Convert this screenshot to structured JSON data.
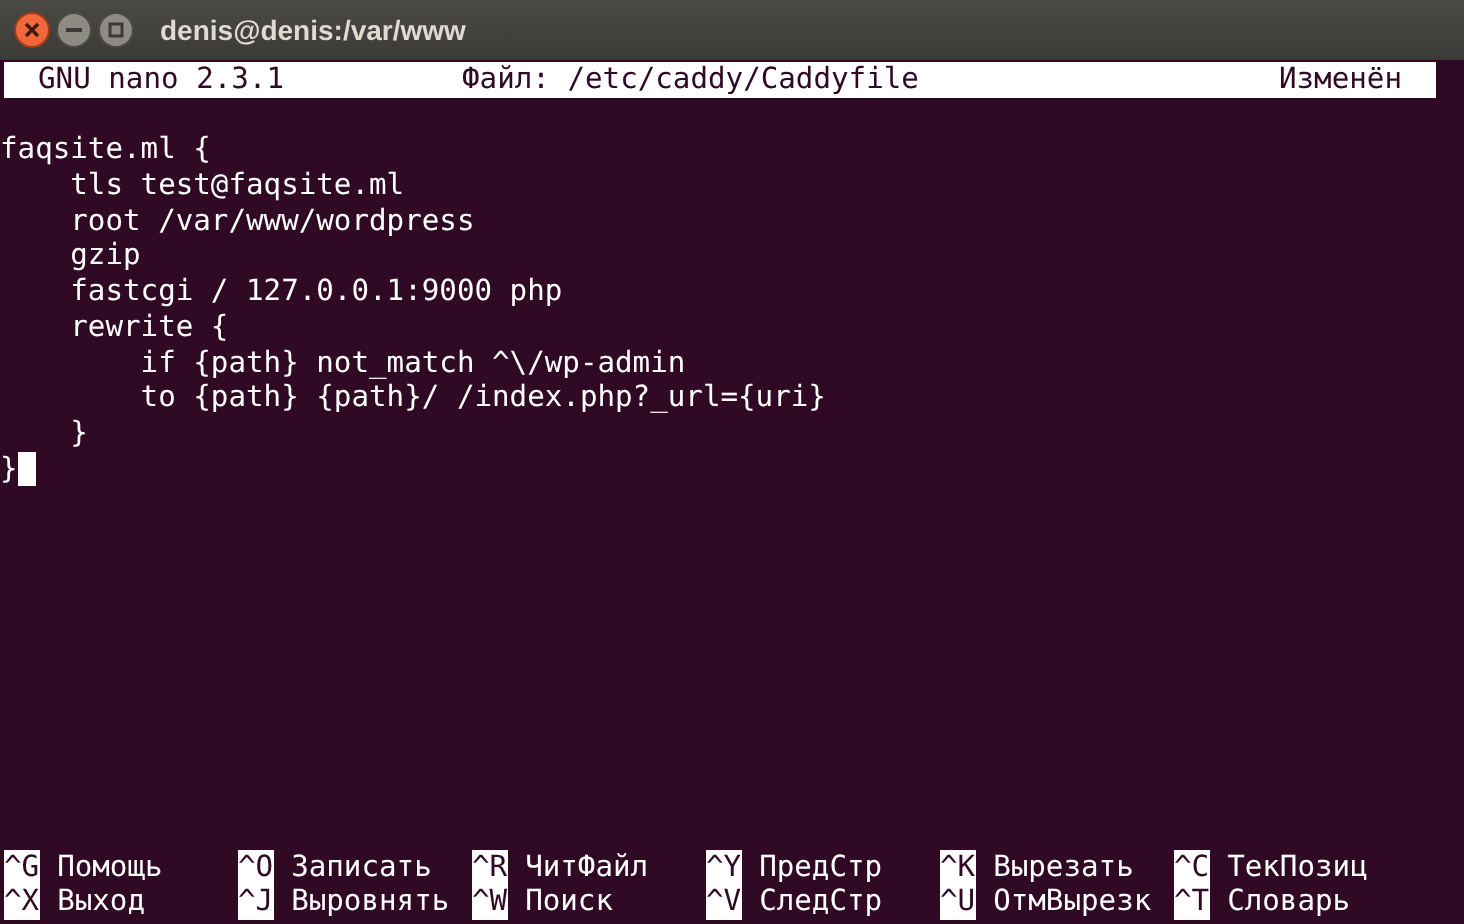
{
  "window": {
    "title": "denis@denis:/var/www"
  },
  "header": {
    "program": "GNU nano 2.3.1",
    "file": "Файл: /etc/caddy/Caddyfile",
    "status": "Изменён"
  },
  "lines": [
    {
      "text": "faqsite.ml {",
      "cursor": false
    },
    {
      "text": "    tls test@faqsite.ml",
      "cursor": false
    },
    {
      "text": "    root /var/www/wordpress",
      "cursor": false
    },
    {
      "text": "    gzip",
      "cursor": false
    },
    {
      "text": "    fastcgi / 127.0.0.1:9000 php",
      "cursor": false
    },
    {
      "text": "    rewrite {",
      "cursor": false
    },
    {
      "text": "        if {path} not_match ^\\/wp-admin",
      "cursor": false
    },
    {
      "text": "        to {path} {path}/ /index.php?_url={uri}",
      "cursor": false
    },
    {
      "text": "    }",
      "cursor": false
    },
    {
      "text": "}",
      "cursor": true
    }
  ],
  "shortcuts": [
    [
      {
        "key": "^G",
        "label": "Помощь"
      },
      {
        "key": "^O",
        "label": "Записать"
      },
      {
        "key": "^R",
        "label": "ЧитФайл"
      },
      {
        "key": "^Y",
        "label": "ПредСтр"
      },
      {
        "key": "^K",
        "label": "Вырезать"
      },
      {
        "key": "^C",
        "label": "ТекПозиц"
      }
    ],
    [
      {
        "key": "^X",
        "label": "Выход"
      },
      {
        "key": "^J",
        "label": "Выровнять"
      },
      {
        "key": "^W",
        "label": "Поиск"
      },
      {
        "key": "^V",
        "label": "СледСтр"
      },
      {
        "key": "^U",
        "label": "ОтмВырезк"
      },
      {
        "key": "^T",
        "label": "Словарь"
      }
    ]
  ]
}
